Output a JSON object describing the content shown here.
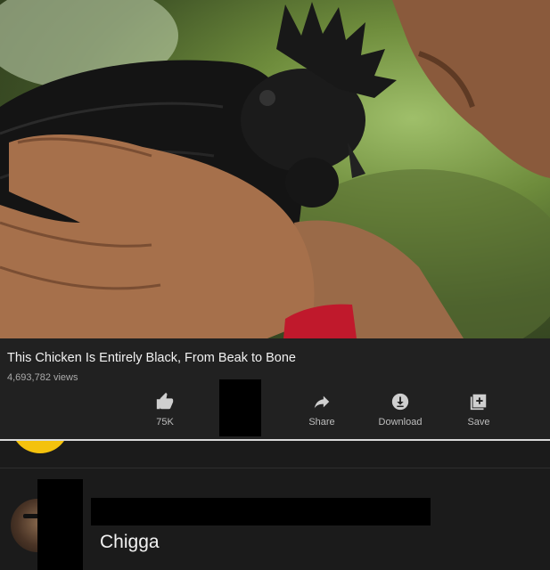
{
  "video": {
    "title": "This Chicken Is Entirely Black, From Beak to Bone",
    "views": "4,693,782 views"
  },
  "actions": [
    {
      "icon": "thumbs-up-icon",
      "label": "75K"
    },
    {
      "icon": "share-icon",
      "label": "Share"
    },
    {
      "icon": "download-icon",
      "label": "Download"
    },
    {
      "icon": "save-icon",
      "label": "Save"
    }
  ],
  "comment": {
    "text": "Chigga"
  },
  "colors": {
    "panel_bg": "#212121",
    "comments_bg": "#1b1b1b",
    "text_primary": "#f1f1f1",
    "text_secondary": "#aaaaaa",
    "accent_avatar": "#f4c20d"
  }
}
